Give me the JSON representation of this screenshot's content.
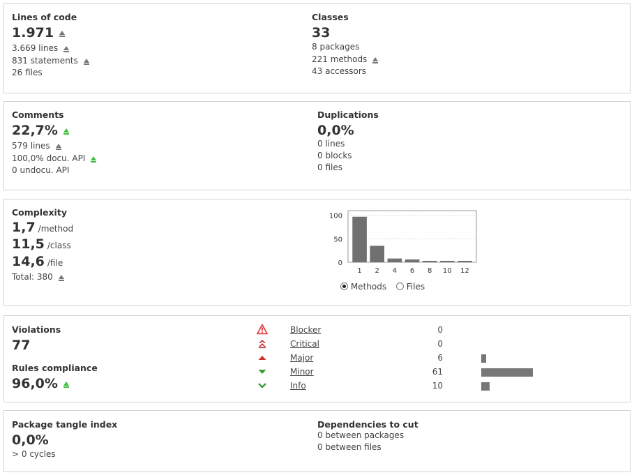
{
  "size_panel": {
    "loc_title": "Lines of code",
    "loc_value": "1.971",
    "lines": "3.669 lines",
    "statements": "831 statements",
    "files": "26 files",
    "classes_title": "Classes",
    "classes_value": "33",
    "packages": "8 packages",
    "methods": "221 methods",
    "accessors": "43 accessors"
  },
  "comments_panel": {
    "comments_title": "Comments",
    "comments_value": "22,7%",
    "comment_lines": "579 lines",
    "docu_api": "100,0% docu. API",
    "undocu_api": "0 undocu. API",
    "dup_title": "Duplications",
    "dup_value": "0,0%",
    "dup_lines": "0 lines",
    "dup_blocks": "0 blocks",
    "dup_files": "0 files"
  },
  "complexity_panel": {
    "title": "Complexity",
    "per_method_value": "1,7",
    "per_method_unit": "/method",
    "per_class_value": "11,5",
    "per_class_unit": "/class",
    "per_file_value": "14,6",
    "per_file_unit": "/file",
    "total": "Total: 380",
    "radio_methods": "Methods",
    "radio_files": "Files",
    "selected": "Methods"
  },
  "chart_data": {
    "type": "bar",
    "categories": [
      "1",
      "2",
      "4",
      "6",
      "8",
      "10",
      "12"
    ],
    "values": [
      97,
      35,
      8,
      6,
      3,
      3,
      3
    ],
    "ylim": [
      0,
      110
    ],
    "yticks": [
      "0",
      "50",
      "100"
    ],
    "grid": true,
    "bar_color": "#707070"
  },
  "violations_panel": {
    "violations_title": "Violations",
    "violations_value": "77",
    "compliance_title": "Rules compliance",
    "compliance_value": "96,0%",
    "severities": [
      {
        "label": "Blocker",
        "count": "0",
        "share": 0,
        "icon": "blocker-icon"
      },
      {
        "label": "Critical",
        "count": "0",
        "share": 0,
        "icon": "critical-icon"
      },
      {
        "label": "Major",
        "count": "6",
        "share": 0.098,
        "icon": "major-icon"
      },
      {
        "label": "Minor",
        "count": "61",
        "share": 1.0,
        "icon": "minor-icon"
      },
      {
        "label": "Info",
        "count": "10",
        "share": 0.164,
        "icon": "info-icon"
      }
    ]
  },
  "tangle_panel": {
    "tangle_title": "Package tangle index",
    "tangle_value": "0,0%",
    "cycles": "> 0 cycles",
    "deps_title": "Dependencies to cut",
    "between_packages": "0 between packages",
    "between_files": "0 between files"
  },
  "colors": {
    "trend_gray": "#777777",
    "trend_green": "#3fbf3f",
    "blocker": "#e03030",
    "critical": "#c03030",
    "major": "#d03030",
    "minor": "#3a9c3a"
  }
}
